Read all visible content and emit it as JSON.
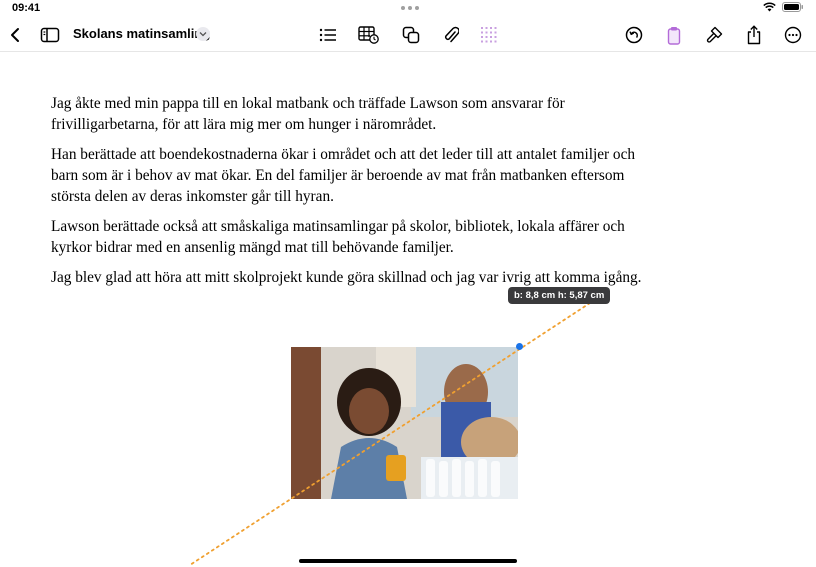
{
  "status": {
    "time": "09:41"
  },
  "toolbar": {
    "doc_title": "Skolans matinsamling",
    "left_icons": [
      "back-chevron-icon",
      "sidebar-icon"
    ],
    "center_icons": [
      "list-icon",
      "table-icon",
      "shapes-icon",
      "attachment-icon",
      "grid-dots-icon"
    ],
    "right_icons": [
      "undo-icon",
      "clipboard-icon",
      "format-brush-icon",
      "share-icon",
      "more-icon"
    ],
    "accent_color": "#b36bd8"
  },
  "document": {
    "paragraphs": [
      "Jag åkte med min pappa till en lokal matbank och träffade Lawson som ansvarar för frivilligarbetarna, för att lära mig mer om hunger i närområdet.",
      "Han berättade att boendekostnaderna ökar i området och att det leder till att antalet familjer och barn som är i behov av mat ökar. En del familjer är beroende av mat från matbanken eftersom största delen av deras inkomster går till hyran.",
      "Lawson berättade också att småskaliga matinsamlingar på skolor, bibliotek, lokala affärer och kyrkor bidrar med en ansenlig mängd mat till behövande familjer.",
      "Jag blev glad att höra att mitt skolprojekt kunde göra skillnad och jag var ivrig att komma igång."
    ]
  },
  "image": {
    "size_label": "b: 8,8 cm  h: 5,87 cm",
    "guide_color": "#f0a030",
    "handle_color": "#1a73e8"
  }
}
